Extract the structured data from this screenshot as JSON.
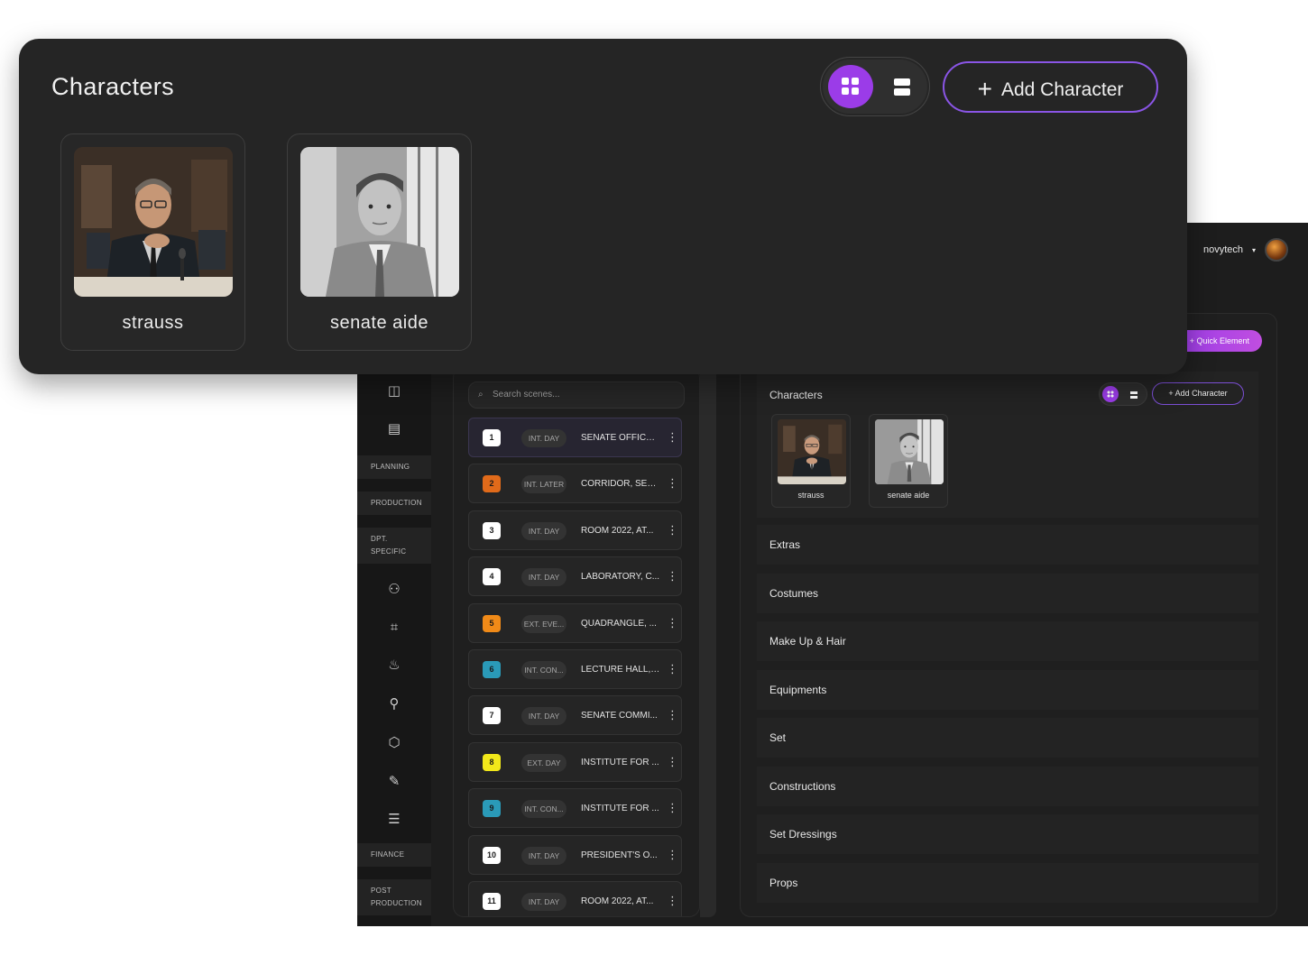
{
  "foreground": {
    "title": "Characters",
    "add_button": "Add Character",
    "characters": [
      {
        "name": "strauss"
      },
      {
        "name": "senate aide"
      }
    ]
  },
  "app": {
    "user_name": "novytech",
    "quick_element": "Quick Element",
    "nav_sections": [
      "PLANNING",
      "PRODUCTION",
      "DPT. SPECIFIC",
      "FINANCE",
      "POST PRODUCTION"
    ],
    "search_placeholder": "Search scenes...",
    "scenes": [
      {
        "num": "1",
        "tag": "INT. DAY",
        "loc": "SENATE OFFICE ...",
        "color": "#ffffff"
      },
      {
        "num": "2",
        "tag": "INT. LATER",
        "loc": "CORRIDOR, SEN...",
        "color": "#e06a1a"
      },
      {
        "num": "3",
        "tag": "INT. DAY",
        "loc": "ROOM 2022, AT...",
        "color": "#ffffff"
      },
      {
        "num": "4",
        "tag": "INT. DAY",
        "loc": "LABORATORY, C...",
        "color": "#ffffff"
      },
      {
        "num": "5",
        "tag": "EXT. EVE...",
        "loc": "QUADRANGLE, ...",
        "color": "#f08a18"
      },
      {
        "num": "6",
        "tag": "INT. CON...",
        "loc": "LECTURE HALL, ...",
        "color": "#2a9ab8"
      },
      {
        "num": "7",
        "tag": "INT. DAY",
        "loc": "SENATE COMMI...",
        "color": "#ffffff"
      },
      {
        "num": "8",
        "tag": "EXT. DAY",
        "loc": "INSTITUTE FOR ...",
        "color": "#f2e81a"
      },
      {
        "num": "9",
        "tag": "INT. CON...",
        "loc": "INSTITUTE FOR ...",
        "color": "#2a9ab8"
      },
      {
        "num": "10",
        "tag": "INT. DAY",
        "loc": "PRESIDENT'S O...",
        "color": "#ffffff"
      },
      {
        "num": "11",
        "tag": "INT. DAY",
        "loc": "ROOM 2022, AT...",
        "color": "#ffffff"
      }
    ],
    "detail": {
      "characters_title": "Characters",
      "add_button": "Add Character",
      "characters": [
        {
          "name": "strauss"
        },
        {
          "name": "senate aide"
        }
      ],
      "sections": [
        "Extras",
        "Costumes",
        "Make Up & Hair",
        "Equipments",
        "Set",
        "Constructions",
        "Set Dressings",
        "Props"
      ]
    }
  },
  "colors": {
    "accent": "#9b3ce8",
    "panel": "#252525",
    "app_bg": "#1d1d1d"
  }
}
